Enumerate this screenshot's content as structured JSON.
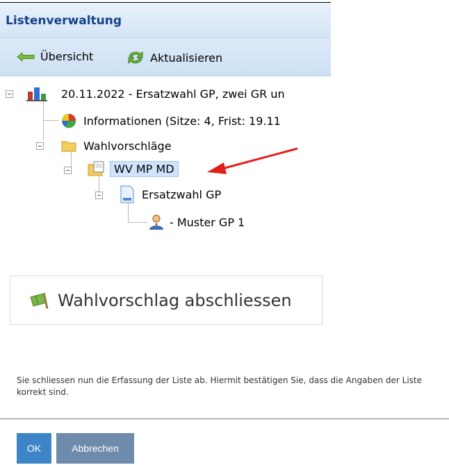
{
  "header": {
    "title": "Listenverwaltung"
  },
  "toolbar": {
    "back_label": "Übersicht",
    "refresh_label": "Aktualisieren"
  },
  "tree": {
    "root": "20.11.2022 - Ersatzwahl GP, zwei GR un",
    "info": "Informationen (Sitze: 4, Frist: 19.11",
    "folder": "Wahlvorschläge",
    "selected": "WV MP MD",
    "document": "Ersatzwahl GP",
    "person": "- Muster GP 1"
  },
  "action": {
    "label": "Wahlvorschlag abschliessen"
  },
  "dialog": {
    "message": "Sie schliessen nun die Erfassung der Liste ab. Hiermit bestätigen Sie, dass die Angaben der Liste korrekt sind.",
    "ok_label": "OK",
    "cancel_label": "Abbrechen"
  },
  "colors": {
    "accent": "#3d85c6",
    "cancel": "#6f8bab",
    "header_text": "#15428b",
    "arrow": "#e0201b"
  }
}
